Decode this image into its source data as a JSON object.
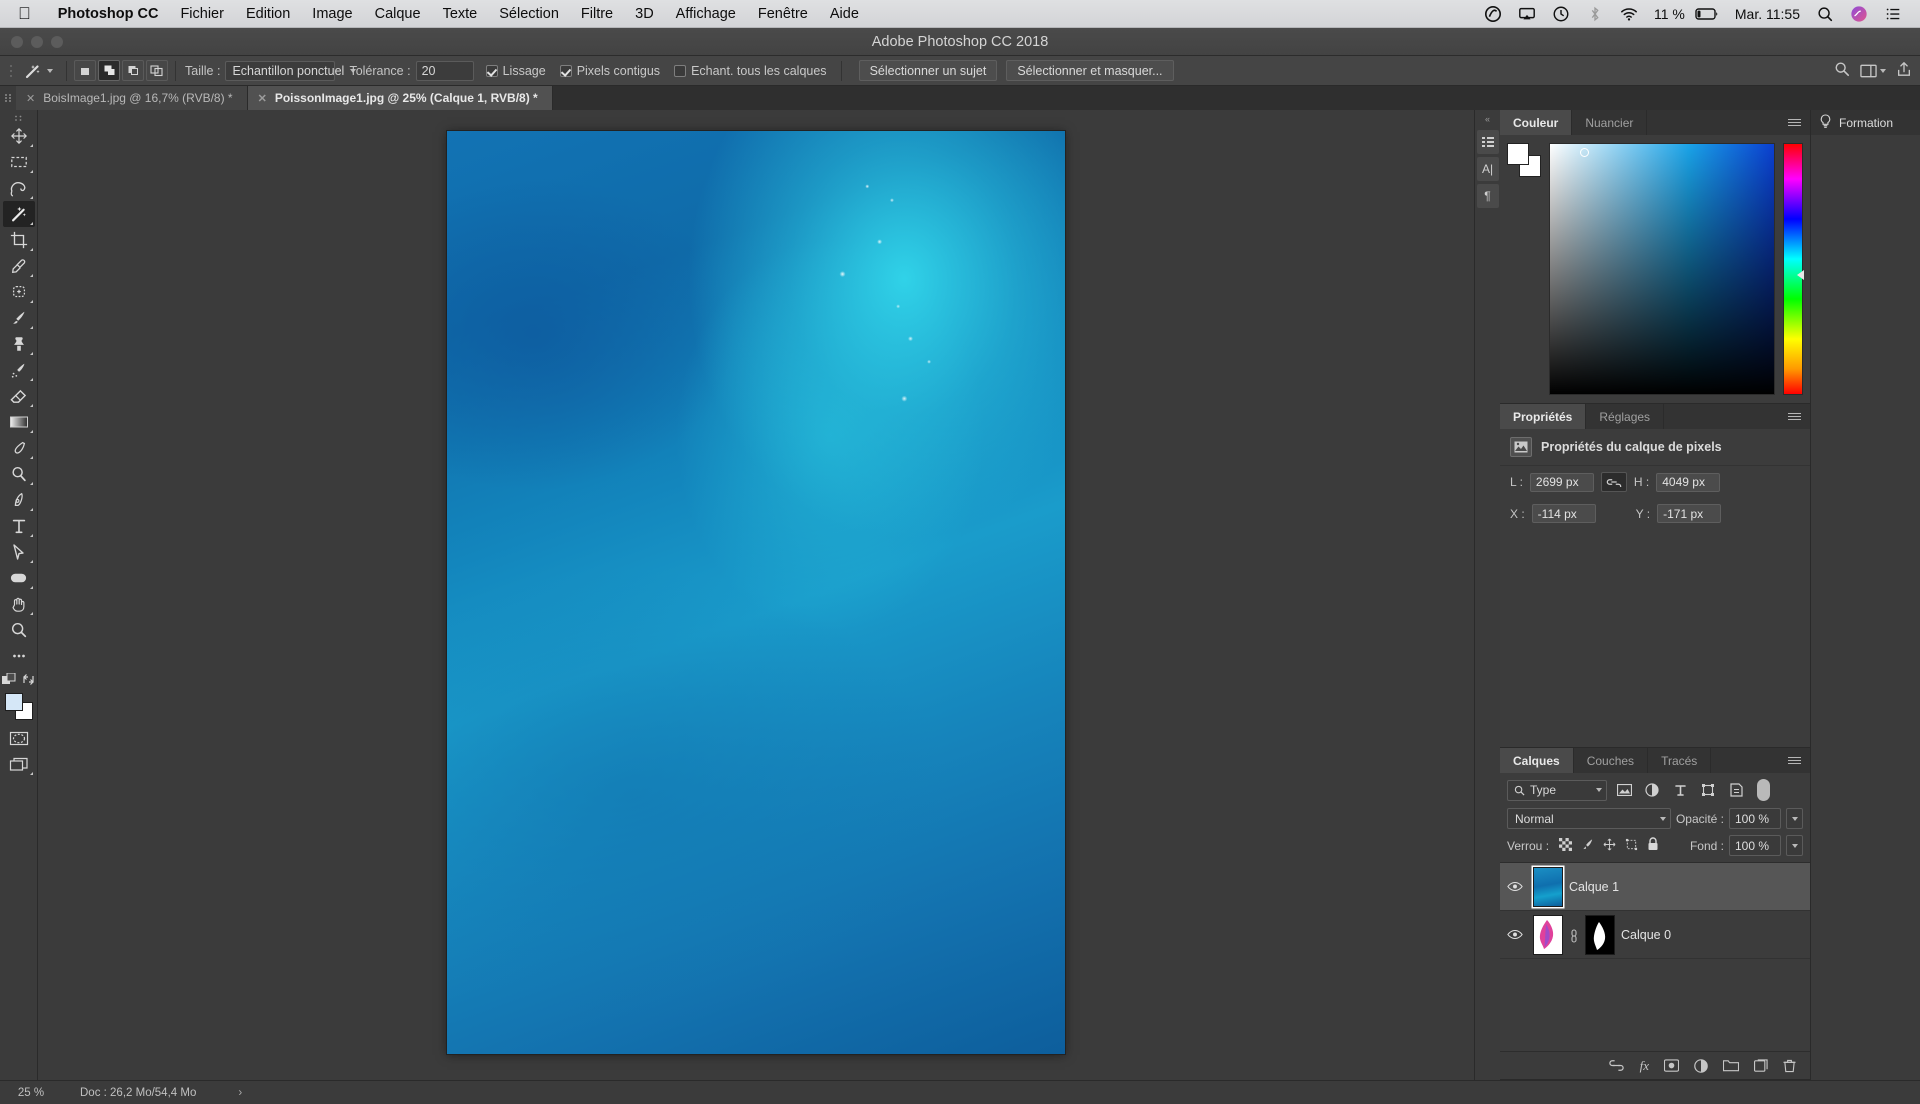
{
  "macbar": {
    "apple": "apple-logo",
    "app_name": "Photoshop CC",
    "menus": [
      "Fichier",
      "Edition",
      "Image",
      "Calque",
      "Texte",
      "Sélection",
      "Filtre",
      "3D",
      "Affichage",
      "Fenêtre",
      "Aide"
    ],
    "status_icons": [
      "creative-cloud-icon",
      "airplay-icon",
      "time-machine-icon",
      "bluetooth-icon",
      "wifi-icon"
    ],
    "battery_percent": "11 %",
    "clock": "Mar. 11:55",
    "right_icons": [
      "search-icon",
      "siri-icon",
      "notification-center-icon"
    ]
  },
  "titlebar": {
    "title": "Adobe Photoshop CC 2018"
  },
  "options_bar": {
    "tool": "magic-wand-tool",
    "selection_modes": [
      "new-selection",
      "add-to-selection",
      "subtract-from-selection",
      "intersect-selection"
    ],
    "active_selection_mode": 1,
    "size_label": "Taille :",
    "size_value": "Echantillon ponctuel",
    "tolerance_label": "Tolérance :",
    "tolerance_value": "20",
    "smoothing_label": "Lissage",
    "smoothing_checked": true,
    "contiguous_label": "Pixels contigus",
    "contiguous_checked": true,
    "all_layers_label": "Echant. tous les calques",
    "all_layers_checked": false,
    "select_subject_button": "Sélectionner un sujet",
    "select_and_mask_button": "Sélectionner et masquer..."
  },
  "tabs": [
    {
      "name": "BoisImage1.jpg @ 16,7% (RVB/8) *",
      "active": false
    },
    {
      "name": "PoissonImage1.jpg @ 25% (Calque 1, RVB/8) *",
      "active": true
    }
  ],
  "toolbar": {
    "tools": [
      "move-tool",
      "rectangular-marquee-tool",
      "lasso-tool",
      "magic-wand-tool",
      "crop-tool",
      "eyedropper-tool",
      "spot-healing-brush-tool",
      "brush-tool",
      "clone-stamp-tool",
      "history-brush-tool",
      "eraser-tool",
      "gradient-tool",
      "blur-tool",
      "dodge-tool",
      "pen-tool",
      "type-tool",
      "path-selection-tool",
      "rectangle-tool",
      "hand-tool",
      "zoom-tool",
      "edit-toolbar-tool"
    ],
    "active_tool_index": 3,
    "foreground_color": "#d5e7f7",
    "background_color": "#ffffff",
    "quick_mask": "quick-mask-icon",
    "screen_mode": "screen-mode-icon"
  },
  "mini_column": {
    "icons": [
      "history-panel-icon",
      "character-panel-icon",
      "paragraph-panel-icon"
    ]
  },
  "color_panel": {
    "tabs": [
      "Couleur",
      "Nuancier"
    ],
    "active_tab": 0,
    "menu_icon": "panel-menu-icon"
  },
  "properties_panel": {
    "tabs": [
      "Propriétés",
      "Réglages"
    ],
    "active_tab": 0,
    "heading": "Propriétés du calque de pixels",
    "heading_icon": "pixel-layer-icon",
    "width_label": "L :",
    "width_value": "2699 px",
    "link_icon": "link-icon",
    "height_label": "H :",
    "height_value": "4049 px",
    "x_label": "X :",
    "x_value": "-114 px",
    "y_label": "Y :",
    "y_value": "-171 px"
  },
  "layers_panel": {
    "tabs": [
      "Calques",
      "Couches",
      "Tracés"
    ],
    "active_tab": 0,
    "filter_type": "Type",
    "filter_icons": [
      "pixel-filter-icon",
      "adjustment-filter-icon",
      "type-filter-icon",
      "shape-filter-icon",
      "smart-object-filter-icon"
    ],
    "blend_mode": "Normal",
    "opacity_label": "Opacité :",
    "opacity_value": "100 %",
    "lock_label": "Verrou :",
    "lock_icons": [
      "lock-transparency-icon",
      "lock-image-icon",
      "lock-position-icon",
      "lock-artboard-icon",
      "lock-all-icon"
    ],
    "fill_label": "Fond :",
    "fill_value": "100 %",
    "layers": [
      {
        "name": "Calque 1",
        "visible": true,
        "selected": true,
        "has_mask": false
      },
      {
        "name": "Calque 0",
        "visible": true,
        "selected": false,
        "has_mask": true
      }
    ],
    "footer_icons": [
      "link-layers-icon",
      "layer-style-icon",
      "layer-mask-icon",
      "adjustment-layer-icon",
      "new-group-icon",
      "new-layer-icon",
      "delete-layer-icon"
    ]
  },
  "formation_panel": {
    "title": "Formation",
    "icon": "lightbulb-icon"
  },
  "status_bar": {
    "zoom": "25 %",
    "doc_info": "Doc : 26,2 Mo/54,4 Mo",
    "arrow": "›"
  }
}
